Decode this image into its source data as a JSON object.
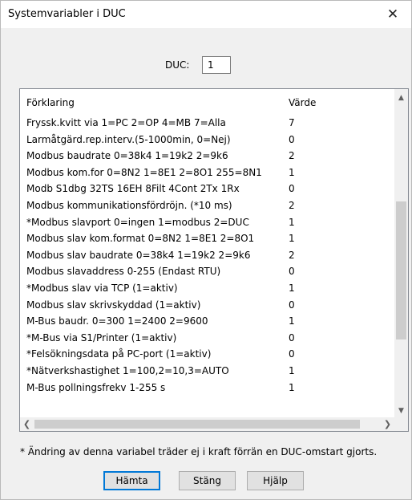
{
  "window": {
    "title": "Systemvariabler i DUC",
    "close_symbol": "✕"
  },
  "duc": {
    "label": "DUC:",
    "value": "1"
  },
  "list": {
    "header_description": "Förklaring",
    "header_value": "Värde",
    "rows": [
      {
        "description": "Fryssk.kvitt via 1=PC 2=OP 4=MB 7=Alla",
        "value": "7"
      },
      {
        "description": "Larmåtgärd.rep.interv.(5-1000min, 0=Nej)",
        "value": "0"
      },
      {
        "description": "Modbus baudrate 0=38k4 1=19k2 2=9k6",
        "value": "2"
      },
      {
        "description": "Modbus kom.for 0=8N2 1=8E1 2=8O1 255=8N1",
        "value": "1"
      },
      {
        "description": "Modb S1dbg 32TS 16EH 8Filt 4Cont 2Tx 1Rx",
        "value": "0"
      },
      {
        "description": "Modbus kommunikationsfördröjn. (*10 ms)",
        "value": "2"
      },
      {
        "description": "*Modbus slavport 0=ingen 1=modbus 2=DUC",
        "value": "1"
      },
      {
        "description": "Modbus slav kom.format 0=8N2 1=8E1 2=8O1",
        "value": "1"
      },
      {
        "description": "Modbus slav baudrate 0=38k4 1=19k2 2=9k6",
        "value": "2"
      },
      {
        "description": "Modbus slavaddress 0-255 (Endast RTU)",
        "value": "0"
      },
      {
        "description": "*Modbus slav via TCP (1=aktiv)",
        "value": "1"
      },
      {
        "description": "Modbus slav skrivskyddad (1=aktiv)",
        "value": "0"
      },
      {
        "description": "M-Bus baudr. 0=300 1=2400 2=9600",
        "value": "1"
      },
      {
        "description": "*M-Bus via S1/Printer (1=aktiv)",
        "value": "0"
      },
      {
        "description": "*Felsökningsdata på PC-port (1=aktiv)",
        "value": "0"
      },
      {
        "description": "*Nätverkshastighet 1=100,2=10,3=AUTO",
        "value": "1"
      },
      {
        "description": "M-Bus pollningsfrekv 1-255 s",
        "value": "1"
      }
    ],
    "scroll_up": "▲",
    "scroll_down": "▼",
    "scroll_left": "❮",
    "scroll_right": "❯"
  },
  "footnote": "* Ändring av denna variabel träder ej i kraft förrän en DUC-omstart gjorts.",
  "buttons": {
    "fetch": "Hämta",
    "close": "Stäng",
    "help": "Hjälp"
  },
  "colors": {
    "accent": "#0078d7",
    "window_bg": "#f0f0f0",
    "scroll_thumb": "#cdcdcd"
  }
}
